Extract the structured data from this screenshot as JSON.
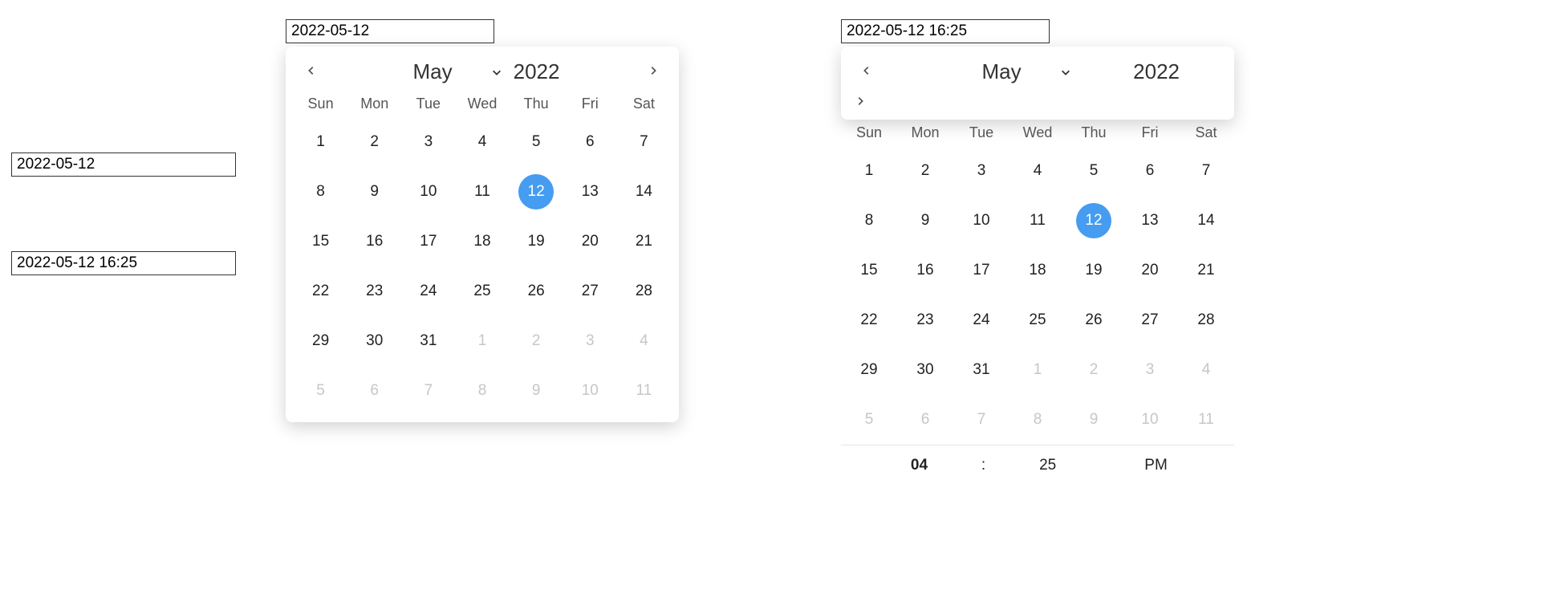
{
  "left_inputs": {
    "date_value": "2022-05-12",
    "datetime_value": "2022-05-12 16:25"
  },
  "date_picker": {
    "input_value": "2022-05-12",
    "month": "May",
    "year": "2022",
    "weekdays": [
      "Sun",
      "Mon",
      "Tue",
      "Wed",
      "Thu",
      "Fri",
      "Sat"
    ],
    "days": [
      {
        "n": "1",
        "m": "cur"
      },
      {
        "n": "2",
        "m": "cur"
      },
      {
        "n": "3",
        "m": "cur"
      },
      {
        "n": "4",
        "m": "cur"
      },
      {
        "n": "5",
        "m": "cur"
      },
      {
        "n": "6",
        "m": "cur"
      },
      {
        "n": "7",
        "m": "cur"
      },
      {
        "n": "8",
        "m": "cur"
      },
      {
        "n": "9",
        "m": "cur"
      },
      {
        "n": "10",
        "m": "cur"
      },
      {
        "n": "11",
        "m": "cur"
      },
      {
        "n": "12",
        "m": "sel"
      },
      {
        "n": "13",
        "m": "cur"
      },
      {
        "n": "14",
        "m": "cur"
      },
      {
        "n": "15",
        "m": "cur"
      },
      {
        "n": "16",
        "m": "cur"
      },
      {
        "n": "17",
        "m": "cur"
      },
      {
        "n": "18",
        "m": "cur"
      },
      {
        "n": "19",
        "m": "cur"
      },
      {
        "n": "20",
        "m": "cur"
      },
      {
        "n": "21",
        "m": "cur"
      },
      {
        "n": "22",
        "m": "cur"
      },
      {
        "n": "23",
        "m": "cur"
      },
      {
        "n": "24",
        "m": "cur"
      },
      {
        "n": "25",
        "m": "cur"
      },
      {
        "n": "26",
        "m": "cur"
      },
      {
        "n": "27",
        "m": "cur"
      },
      {
        "n": "28",
        "m": "cur"
      },
      {
        "n": "29",
        "m": "cur"
      },
      {
        "n": "30",
        "m": "cur"
      },
      {
        "n": "31",
        "m": "cur"
      },
      {
        "n": "1",
        "m": "next"
      },
      {
        "n": "2",
        "m": "next"
      },
      {
        "n": "3",
        "m": "next"
      },
      {
        "n": "4",
        "m": "next"
      },
      {
        "n": "5",
        "m": "next"
      },
      {
        "n": "6",
        "m": "next"
      },
      {
        "n": "7",
        "m": "next"
      },
      {
        "n": "8",
        "m": "next"
      },
      {
        "n": "9",
        "m": "next"
      },
      {
        "n": "10",
        "m": "next"
      },
      {
        "n": "11",
        "m": "next"
      }
    ]
  },
  "datetime_picker": {
    "input_value": "2022-05-12 16:25",
    "month": "May",
    "year": "2022",
    "weekdays": [
      "Sun",
      "Mon",
      "Tue",
      "Wed",
      "Thu",
      "Fri",
      "Sat"
    ],
    "days": [
      {
        "n": "1",
        "m": "cur"
      },
      {
        "n": "2",
        "m": "cur"
      },
      {
        "n": "3",
        "m": "cur"
      },
      {
        "n": "4",
        "m": "cur"
      },
      {
        "n": "5",
        "m": "cur"
      },
      {
        "n": "6",
        "m": "cur"
      },
      {
        "n": "7",
        "m": "cur"
      },
      {
        "n": "8",
        "m": "cur"
      },
      {
        "n": "9",
        "m": "cur"
      },
      {
        "n": "10",
        "m": "cur"
      },
      {
        "n": "11",
        "m": "cur"
      },
      {
        "n": "12",
        "m": "sel"
      },
      {
        "n": "13",
        "m": "cur"
      },
      {
        "n": "14",
        "m": "cur"
      },
      {
        "n": "15",
        "m": "cur"
      },
      {
        "n": "16",
        "m": "cur"
      },
      {
        "n": "17",
        "m": "cur"
      },
      {
        "n": "18",
        "m": "cur"
      },
      {
        "n": "19",
        "m": "cur"
      },
      {
        "n": "20",
        "m": "cur"
      },
      {
        "n": "21",
        "m": "cur"
      },
      {
        "n": "22",
        "m": "cur"
      },
      {
        "n": "23",
        "m": "cur"
      },
      {
        "n": "24",
        "m": "cur"
      },
      {
        "n": "25",
        "m": "cur"
      },
      {
        "n": "26",
        "m": "cur"
      },
      {
        "n": "27",
        "m": "cur"
      },
      {
        "n": "28",
        "m": "cur"
      },
      {
        "n": "29",
        "m": "cur"
      },
      {
        "n": "30",
        "m": "cur"
      },
      {
        "n": "31",
        "m": "cur"
      },
      {
        "n": "1",
        "m": "next"
      },
      {
        "n": "2",
        "m": "next"
      },
      {
        "n": "3",
        "m": "next"
      },
      {
        "n": "4",
        "m": "next"
      },
      {
        "n": "5",
        "m": "next"
      },
      {
        "n": "6",
        "m": "next"
      },
      {
        "n": "7",
        "m": "next"
      },
      {
        "n": "8",
        "m": "next"
      },
      {
        "n": "9",
        "m": "next"
      },
      {
        "n": "10",
        "m": "next"
      },
      {
        "n": "11",
        "m": "next"
      }
    ],
    "time": {
      "hour": "04",
      "sep": ":",
      "minute": "25",
      "ampm": "PM"
    }
  }
}
